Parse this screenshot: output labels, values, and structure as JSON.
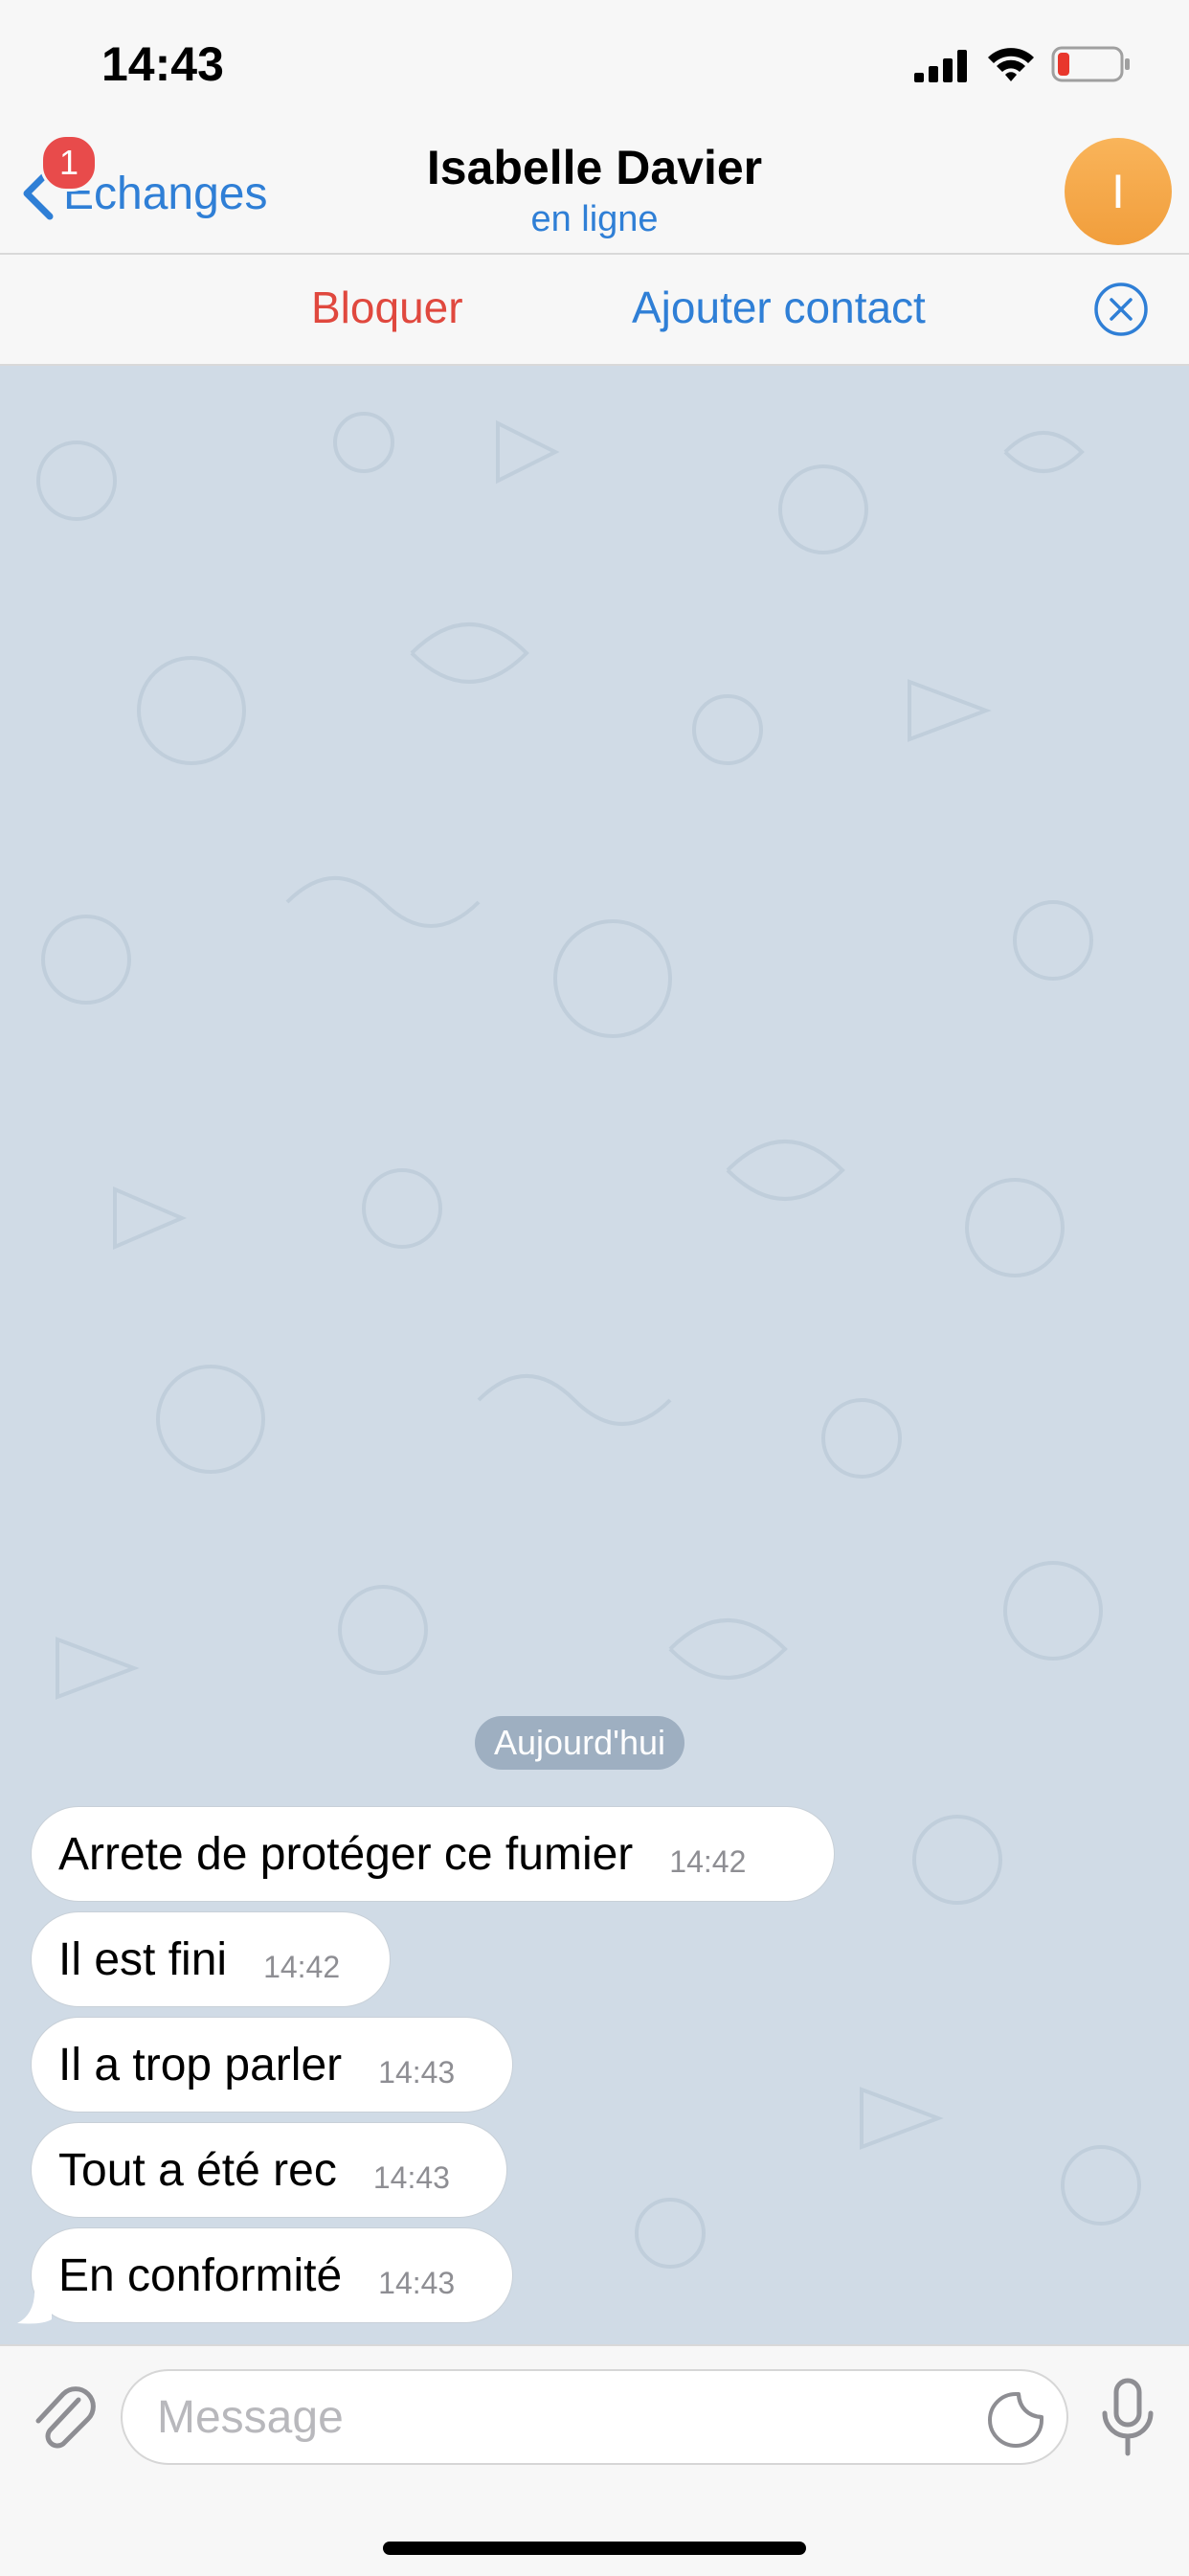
{
  "status_bar": {
    "time": "14:43",
    "icons": [
      "signal-icon",
      "wifi-icon",
      "battery-low-icon"
    ]
  },
  "nav": {
    "back_label": "Échanges",
    "unread_badge": "1",
    "contact_name": "Isabelle Davier",
    "contact_status": "en ligne",
    "avatar_initial": "I",
    "avatar_color": "#f2a444"
  },
  "actions": {
    "block_label": "Bloquer",
    "add_contact_label": "Ajouter contact",
    "close_icon": "close-circle-icon"
  },
  "chat": {
    "date_separator": "Aujourd'hui",
    "messages": [
      {
        "text": "Arrete de protéger ce fumier",
        "time": "14:42"
      },
      {
        "text": "Il est fini",
        "time": "14:42"
      },
      {
        "text": "Il a trop parler",
        "time": "14:43"
      },
      {
        "text": "Tout a été rec",
        "time": "14:43"
      },
      {
        "text": "En conformité",
        "time": "14:43"
      }
    ]
  },
  "input": {
    "placeholder": "Message",
    "icons": [
      "paperclip-icon",
      "sticker-icon",
      "microphone-icon"
    ]
  },
  "colors": {
    "accent": "#2f7fd6",
    "danger": "#e0483e",
    "chat_background": "#d0dbe6"
  }
}
